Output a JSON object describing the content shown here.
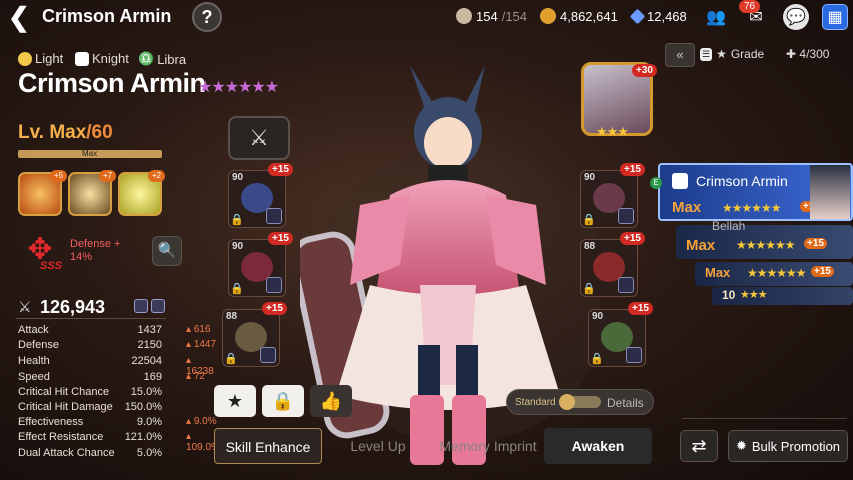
{
  "header": {
    "title": "Crimson Armin",
    "help_label": "?",
    "stamina": "154",
    "stamina_max": "/154",
    "gold": "4,862,641",
    "crystals": "12,468",
    "mail_badge": "76"
  },
  "hero": {
    "attribute": "Light",
    "class": "Knight",
    "horoscope": "Libra",
    "name": "Crimson Armin",
    "stars": "★★★★★★",
    "level_prefix": "Lv. Max",
    "level_max": "/60",
    "level_bar_label": "Max",
    "artifacts": [
      {
        "badge": "+5",
        "color": "#d86a1a"
      },
      {
        "badge": "+7",
        "color": "#c89a40"
      },
      {
        "badge": "+2",
        "color": "#e8d840"
      }
    ],
    "imprint_rank": "SSS",
    "imprint_stat": "Defense +",
    "imprint_value": "14%",
    "combat_power": "126,943"
  },
  "stats": [
    {
      "label": "Attack",
      "value": "1437",
      "bonus": "616"
    },
    {
      "label": "Defense",
      "value": "2150",
      "bonus": "1447"
    },
    {
      "label": "Health",
      "value": "22504",
      "bonus": "16238"
    },
    {
      "label": "Speed",
      "value": "169",
      "bonus": "72"
    },
    {
      "label": "Critical Hit Chance",
      "value": "15.0%",
      "bonus": ""
    },
    {
      "label": "Critical Hit Damage",
      "value": "150.0%",
      "bonus": ""
    },
    {
      "label": "Effectiveness",
      "value": "9.0%",
      "bonus": "9.0%"
    },
    {
      "label": "Effect Resistance",
      "value": "121.0%",
      "bonus": "109.0%"
    },
    {
      "label": "Dual Attack Chance",
      "value": "5.0%",
      "bonus": ""
    }
  ],
  "gear": {
    "left": [
      {
        "level": "90",
        "plus": "+15",
        "color": "#3a4a8a"
      },
      {
        "level": "90",
        "plus": "+15",
        "color": "#7a2a3a"
      },
      {
        "level": "88",
        "plus": "+15",
        "color": "#6a5a40"
      }
    ],
    "right": [
      {
        "level": "90",
        "plus": "+15",
        "color": "#6a3a4a"
      },
      {
        "level": "88",
        "plus": "+15",
        "color": "#8a2a2a"
      },
      {
        "level": "90",
        "plus": "+15",
        "color": "#4a6a3a"
      }
    ]
  },
  "portrait": {
    "badge": "+30",
    "stars": "★★★"
  },
  "bottom": {
    "view_standard": "Standard",
    "view_details": "Details",
    "tabs": [
      "Skill Enhance",
      "Level Up",
      "Memory Imprint",
      "Awaken"
    ],
    "bulk_promotion": "Bulk Promotion"
  },
  "list": {
    "sort_label": "Grade",
    "count": "4/300",
    "cards": [
      {
        "name": "Crimson Armin",
        "level": "Max",
        "stars": "★★★★★★",
        "badge": "+14"
      },
      {
        "name": "Bellah",
        "level": "Max",
        "stars": "★★★★★★",
        "badge": "+15"
      },
      {
        "name": "",
        "level": "Max",
        "stars": "★★★★★★",
        "badge": "+15"
      },
      {
        "name": "",
        "level": "10",
        "stars": "★★★",
        "badge": ""
      }
    ]
  },
  "colors": {
    "accent": "#f08c3c",
    "stars": "#f6c83a",
    "badge_red": "#d22a22",
    "bonus": "#f07848"
  }
}
